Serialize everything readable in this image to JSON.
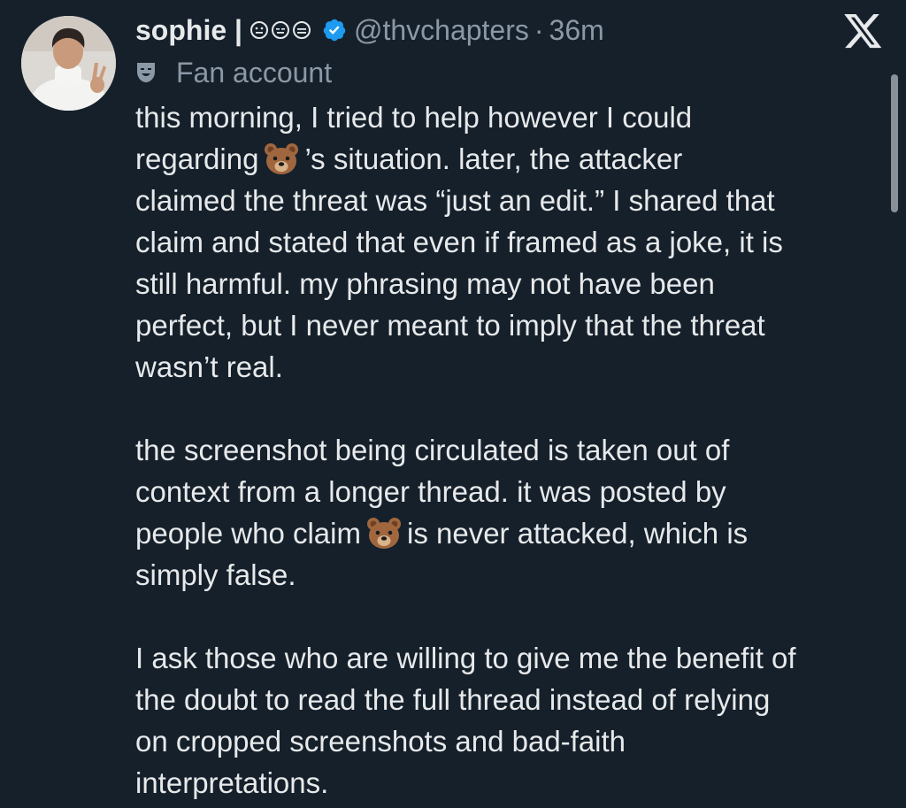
{
  "tweet": {
    "display_name": "sophie |",
    "handle": "@thvchapters",
    "separator": "·",
    "time": "36m",
    "account_label": "Fan account",
    "paragraphs": [
      {
        "line1": "this morning, I tried to help however I could",
        "line2_before": "regarding",
        "line2_after": "’s situation. later, the attacker",
        "line3": "claimed the threat was “just an edit.” I shared that",
        "line4": "claim and stated that even if framed as a joke, it is",
        "line5": "still harmful. my phrasing may not have been",
        "line6": "perfect, but I never meant to imply that the threat",
        "line7": "wasn’t real."
      },
      {
        "line1": "the screenshot being circulated is taken out of",
        "line2": "context from a longer thread. it was posted by",
        "line3_before": "people who claim",
        "line3_after": "is never attacked, which is",
        "line4": "simply false."
      },
      {
        "line1": "I ask those who are willing to give me the benefit of",
        "line2": "the doubt to read the full thread instead of relying",
        "line3": "on cropped screenshots and bad-faith",
        "line4": "interpretations."
      }
    ]
  },
  "icons": {
    "verified": "verified-badge-icon",
    "close": "x-logo-icon",
    "label": "theater-mask-icon",
    "emoji": "bear-emoji"
  },
  "colors": {
    "background": "#15202b",
    "text": "#e7e9ea",
    "secondary": "#8b98a5",
    "verified": "#1d9bf0"
  }
}
